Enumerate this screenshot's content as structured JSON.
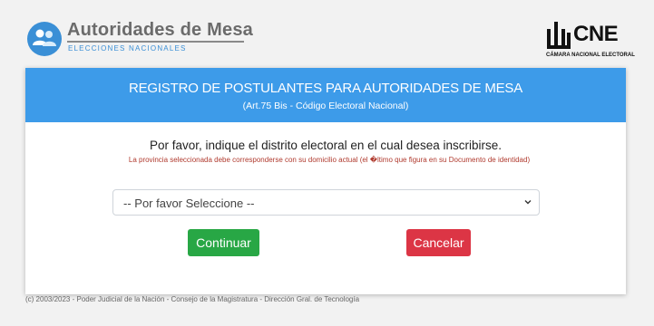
{
  "header": {
    "brand_title": "Autoridades de Mesa",
    "brand_subtitle": "ELECCIONES NACIONALES",
    "cne_text": "CNE",
    "cne_subtitle": "CÁMARA NACIONAL ELECTORAL"
  },
  "form": {
    "title": "REGISTRO DE POSTULANTES PARA AUTORIDADES DE MESA",
    "subtitle": "(Art.75 Bis - Código Electoral Nacional)",
    "prompt": "Por favor, indique el distrito electoral en el cual desea inscribirse.",
    "note": "La provincia seleccionada debe corresponderse con su domicilio actual (el �ltimo que figura en su Documento de identidad)",
    "select_value": "-- Por favor Seleccione --",
    "continue_label": "Continuar",
    "cancel_label": "Cancelar"
  },
  "footer": {
    "text": "(c) 2003/2023 - Poder Judicial de la Nación - Consejo de la Magistratura - Dirección Gral. de Tecnología"
  },
  "colors": {
    "header_blue": "#3d9be9",
    "continue_green": "#28a745",
    "cancel_red": "#dc3545",
    "brand_blue": "#3a8fd6"
  },
  "icons": [
    "users-icon",
    "cne-logo-icon",
    "chevron-down-icon"
  ]
}
